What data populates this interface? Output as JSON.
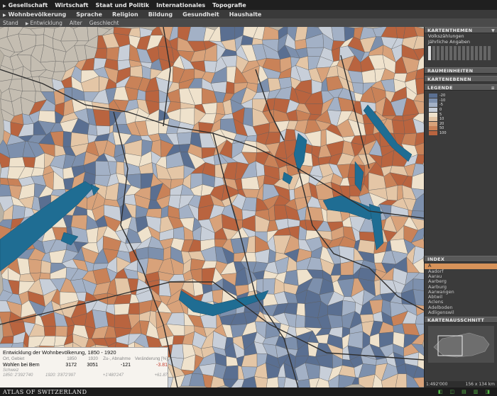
{
  "nav": {
    "top": [
      "Gesellschaft",
      "Wirtschaft",
      "Staat und Politik",
      "Internationales",
      "Topografie"
    ],
    "top_active": 0,
    "sub": [
      "Wohnbevölkerung",
      "Sprache",
      "Religion",
      "Bildung",
      "Gesundheit",
      "Haushalte"
    ],
    "sub_active": 0,
    "subsub": [
      "Stand",
      "Entwicklung",
      "Alter",
      "Geschlecht"
    ],
    "subsub_active": 1
  },
  "sidebar": {
    "kartenthemen": "KARTENTHEMEN",
    "theme_line1": "Volkszählungen",
    "theme_line2": "Jährliche Angaben",
    "raumeinheiten": "RAUMEINHEITEN",
    "kartenebenen": "KARTENEBENEN",
    "legende": "LEGENDE",
    "legend_items": [
      {
        "color": "#5a6f91",
        "label": "-20"
      },
      {
        "color": "#7d90ad",
        "label": "-10"
      },
      {
        "color": "#a3b1c6",
        "label": "-5"
      },
      {
        "color": "#c8cfd9",
        "label": "0"
      },
      {
        "color": "#efe2cc",
        "label": "5"
      },
      {
        "color": "#e4c6a6",
        "label": "10"
      },
      {
        "color": "#d8a27a",
        "label": "20"
      },
      {
        "color": "#c98258",
        "label": "50"
      },
      {
        "color": "#b9643f",
        "label": "100"
      }
    ],
    "index_title": "INDEX",
    "index_items": [
      "A",
      "Aadorf",
      "Aarau",
      "Aarberg",
      "Aarburg",
      "Aarwangen",
      "Abtwil",
      "Aclens",
      "Adelboden",
      "Adligenswil"
    ],
    "index_selected": 0,
    "kartenausschnitt": "KARTENAUSSCHNITT",
    "scale": "1:492'000",
    "extent": "156 x 134 km"
  },
  "info": {
    "title": "Entwicklung der Wohnbevölkerung, 1850 - 1920",
    "head": [
      "Ort, Gebiet",
      "1850",
      "1920",
      "Zu-, Abnahme",
      "Veränderung [%]"
    ],
    "row": [
      "Wohlen bei Bern",
      "3172",
      "3051",
      "-121",
      "-3.81"
    ],
    "region_label": "Schweiz",
    "region_row": [
      "1850: 2'392'740",
      "1920: 3'872'997",
      "+1'480'247",
      "+61.87"
    ]
  },
  "footer": {
    "logo": "ATLAS OF SWITZERLAND"
  },
  "map": {
    "palette": [
      "#5a6f91",
      "#7d90ad",
      "#a3b1c6",
      "#c8cfd9",
      "#efe2cc",
      "#e4c6a6",
      "#d8a27a",
      "#c98258",
      "#b9643f"
    ],
    "lake_color": "#1f6d93"
  }
}
